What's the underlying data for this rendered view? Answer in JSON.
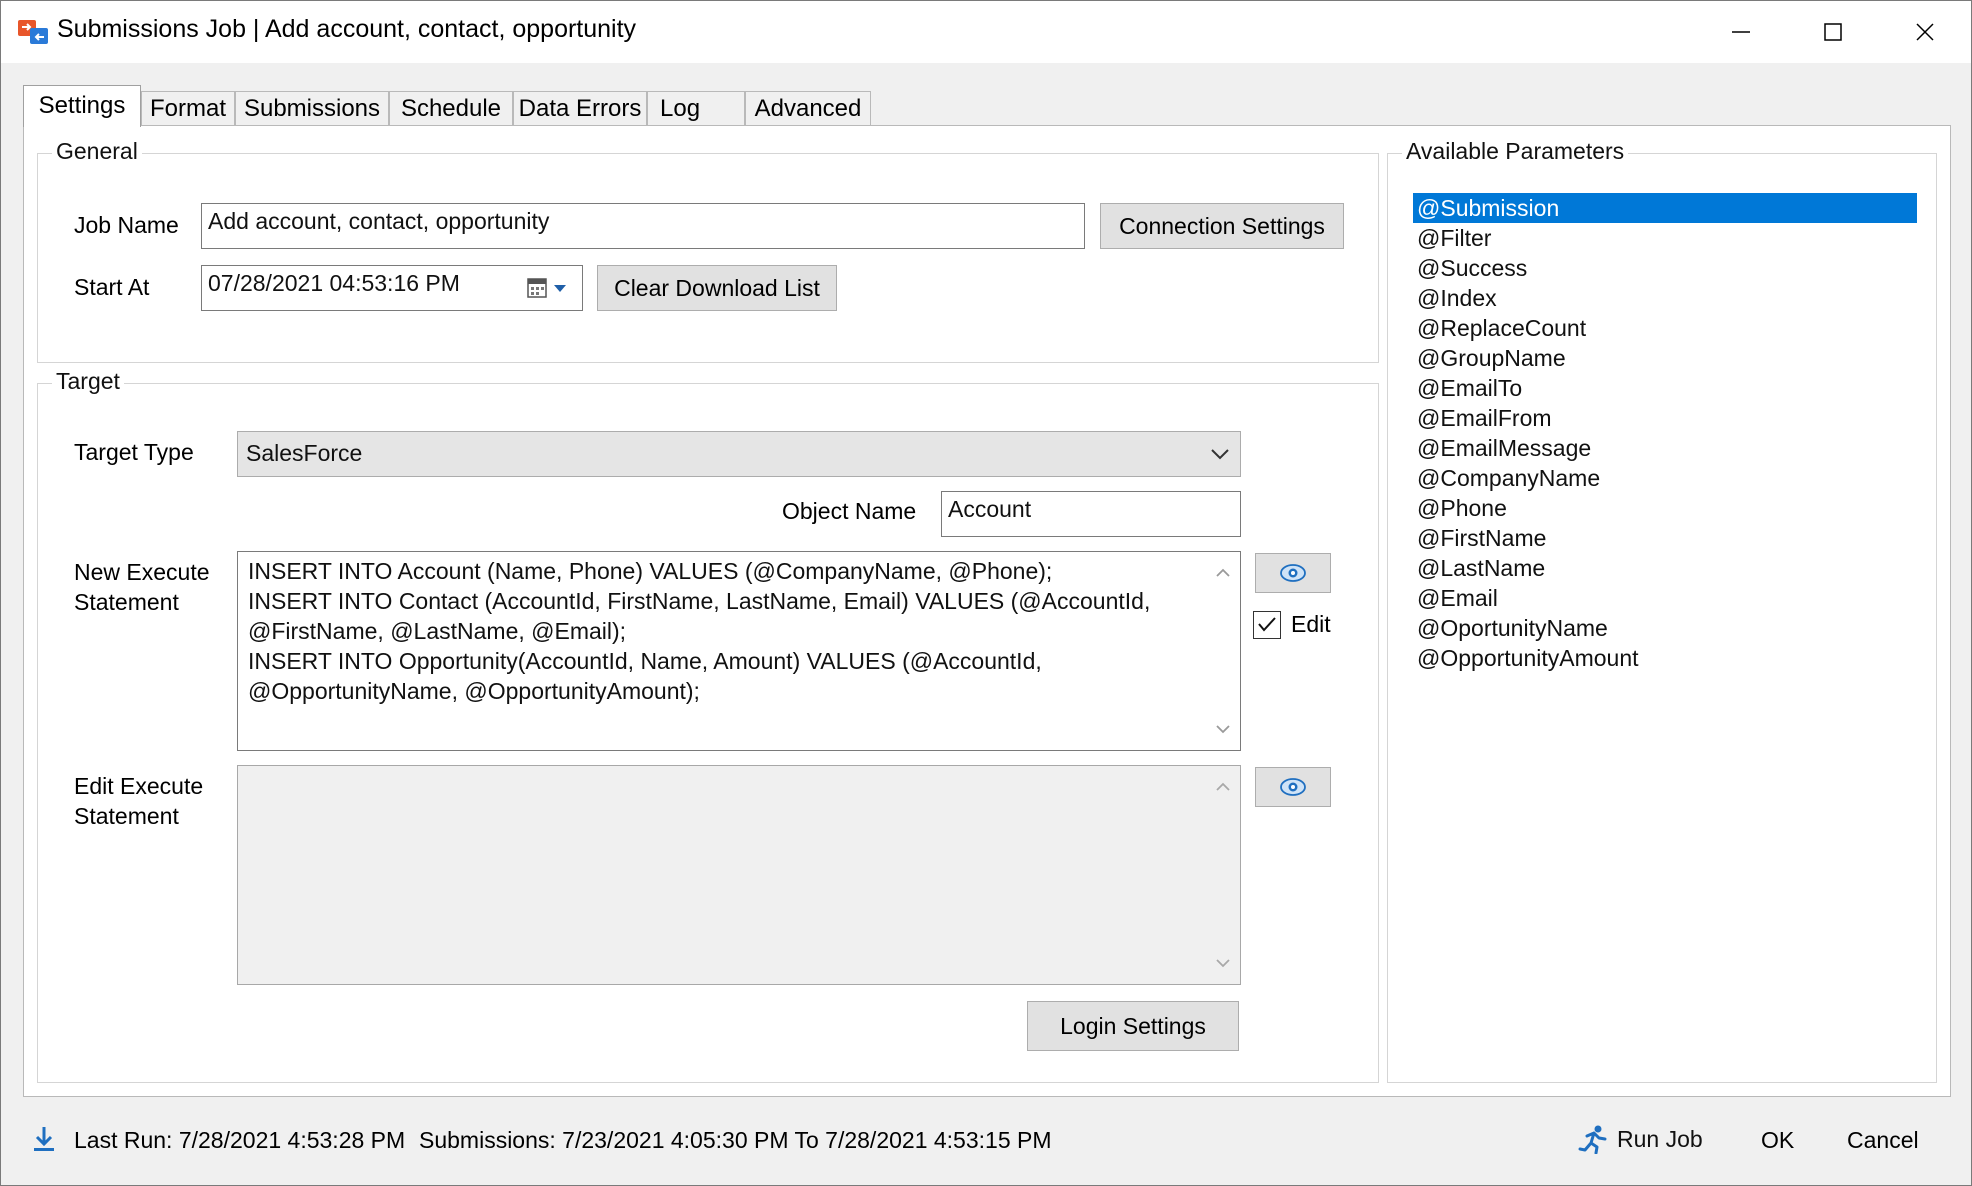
{
  "window": {
    "title": "Submissions Job | Add account, contact, opportunity",
    "icon": "app-transfer-icon"
  },
  "tabs": [
    {
      "label": "Settings",
      "active": true
    },
    {
      "label": "Format"
    },
    {
      "label": "Submissions"
    },
    {
      "label": "Schedule"
    },
    {
      "label": "Data Errors"
    },
    {
      "label": "Log"
    },
    {
      "label": "Advanced"
    }
  ],
  "general": {
    "legend": "General",
    "job_name_label": "Job Name",
    "job_name_value": "Add account, contact, opportunity",
    "connection_settings_label": "Connection Settings",
    "start_at_label": "Start At",
    "start_at_value": "07/28/2021 04:53:16 PM",
    "clear_download_label": "Clear Download List"
  },
  "target": {
    "legend": "Target",
    "target_type_label": "Target Type",
    "target_type_value": "SalesForce",
    "object_name_label": "Object Name",
    "object_name_value": "Account",
    "new_exec_label_1": "New Execute",
    "new_exec_label_2": "Statement",
    "new_exec_lines": [
      "INSERT INTO Account (Name, Phone) VALUES (@CompanyName, @Phone);",
      "INSERT INTO Contact (AccountId, FirstName, LastName, Email) VALUES (@AccountId,",
      "@FirstName, @LastName, @Email);",
      "INSERT INTO Opportunity(AccountId, Name, Amount) VALUES (@AccountId,",
      "@OpportunityName, @OpportunityAmount);"
    ],
    "edit_checkbox_label": "Edit",
    "edit_checked": true,
    "edit_exec_label_1": "Edit Execute",
    "edit_exec_label_2": "Statement",
    "login_settings_label": "Login Settings"
  },
  "parameters": {
    "legend": "Available Parameters",
    "items": [
      "@Submission",
      "@Filter",
      "@Success",
      "@Index",
      "@ReplaceCount",
      "@GroupName",
      "@EmailTo",
      "@EmailFrom",
      "@EmailMessage",
      "@CompanyName",
      "@Phone",
      "@FirstName",
      "@LastName",
      "@Email",
      "@OportunityName",
      "@OpportunityAmount"
    ],
    "selected_index": 0
  },
  "status": {
    "last_run": "Last Run: 7/28/2021 4:53:28 PM",
    "submissions": "Submissions: 7/23/2021 4:05:30 PM To 7/28/2021 4:53:15 PM",
    "run_job_label": "Run Job",
    "ok_label": "OK",
    "cancel_label": "Cancel"
  },
  "colors": {
    "accent": "#0078d7",
    "app_icon_orange": "#e8562a",
    "app_icon_blue": "#2a7ad8"
  }
}
